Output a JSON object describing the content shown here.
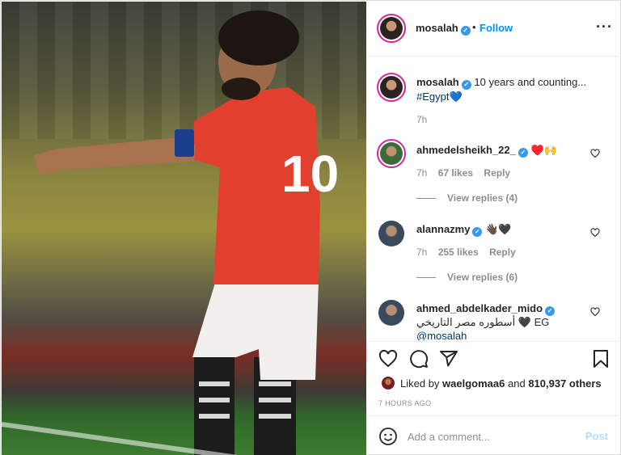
{
  "post": {
    "author": "mosalah",
    "follow_label": "Follow",
    "separator": "•",
    "more_icon": "more-horizontal-icon",
    "caption": {
      "username": "mosalah",
      "text": "10 years and counting...",
      "hashtag": "#Egypt",
      "emoji": "💙",
      "time": "7h"
    },
    "comments": [
      {
        "username": "ahmedelsheikh_22_",
        "verified": true,
        "text": "♥️🙌",
        "time": "7h",
        "likes": "67 likes",
        "reply": "Reply",
        "view_replies": "View replies (4)"
      },
      {
        "username": "alannazmy",
        "verified": true,
        "text": "👋🏿🖤",
        "time": "7h",
        "likes": "255 likes",
        "reply": "Reply",
        "view_replies": "View replies (6)"
      },
      {
        "username": "ahmed_abdelkader_mido",
        "verified": true,
        "text": "أسطوره مصر التاريخي 🖤 EG",
        "mention": "@mosalah"
      }
    ],
    "likes_line": {
      "prefix": "Liked by",
      "user": "waelgomaa6",
      "middle": "and",
      "others": "810,937 others"
    },
    "timestamp": "7 HOURS AGO",
    "composer": {
      "placeholder": "Add a comment...",
      "post_label": "Post"
    }
  },
  "colors": {
    "accent": "#0095f6",
    "verified": "#3897f0",
    "muted": "#8e8e8e",
    "post_disabled": "#b2dffc"
  }
}
